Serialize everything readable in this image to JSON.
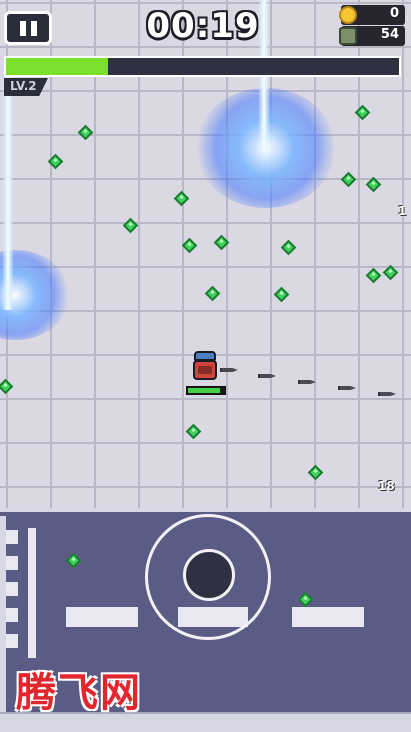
{
  "hud": {
    "timer": "00:19",
    "coins": "0",
    "kills": "54",
    "level": "LV.2",
    "xp_progress": 0.26
  },
  "player": {
    "hp_fraction": 0.9
  },
  "enemy_labels": [
    "1",
    "18"
  ],
  "watermark": "腾飞网",
  "colors": {
    "xp_fill": "#7be02c",
    "gem": "#3dd35c",
    "road": "#5a5c86",
    "floor": "#d9d8e3"
  },
  "icons": [
    "pause-icon",
    "coin-icon",
    "skull-icon",
    "joystick"
  ]
}
